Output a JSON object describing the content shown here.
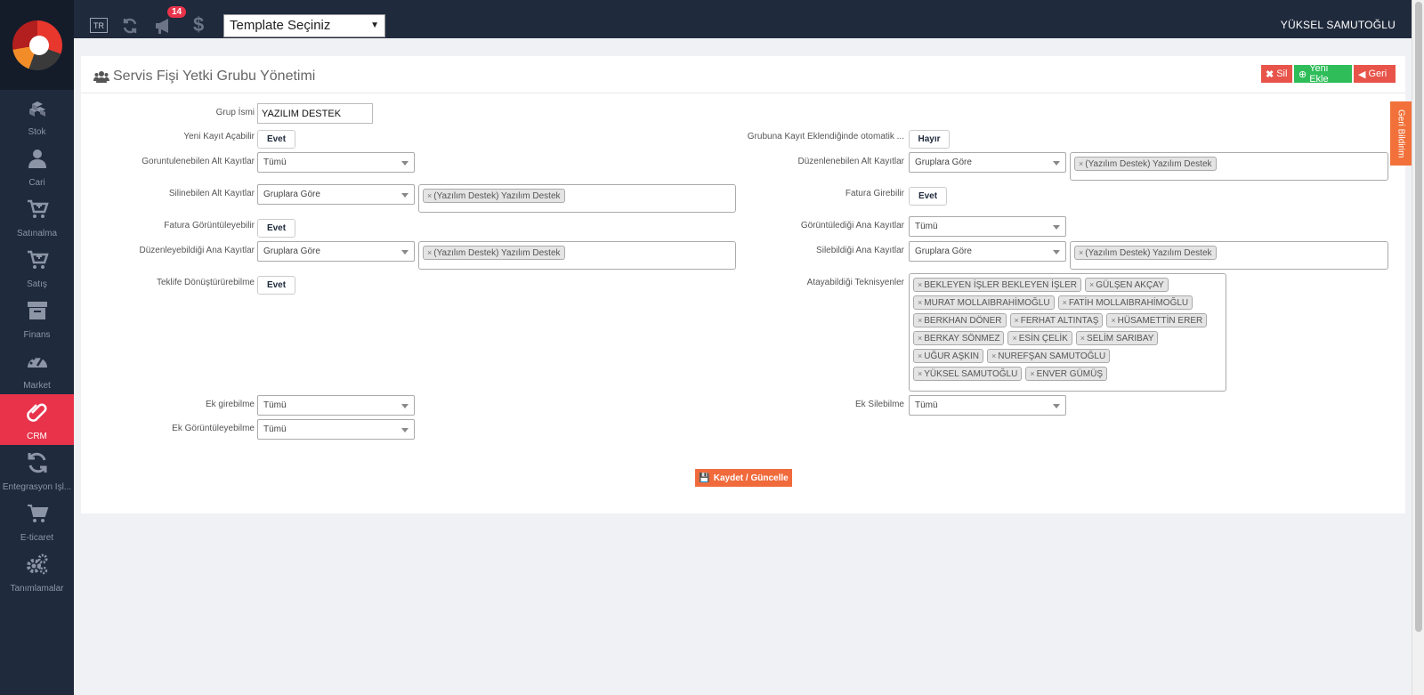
{
  "topbar": {
    "lang": "TR",
    "notification_count": "14",
    "template_select": "Template Seçiniz",
    "username": "YÜKSEL SAMUTOĞLU"
  },
  "sidebar": {
    "items": [
      {
        "label": "Stok",
        "icon": "cubes-icon"
      },
      {
        "label": "Cari",
        "icon": "user-icon"
      },
      {
        "label": "Satınalma",
        "icon": "cart-icon"
      },
      {
        "label": "Satış",
        "icon": "cart-icon"
      },
      {
        "label": "Finans",
        "icon": "archive-icon"
      },
      {
        "label": "Market",
        "icon": "dashboard-icon"
      },
      {
        "label": "CRM",
        "icon": "paperclip-icon",
        "active": true
      },
      {
        "label": "Entegrasyon İşl...",
        "icon": "refresh-icon"
      },
      {
        "label": "E-ticaret",
        "icon": "shopping-cart-icon"
      },
      {
        "label": "Tanımlamalar",
        "icon": "gears-icon"
      }
    ]
  },
  "panel": {
    "title": "Servis Fişi Yetki Grubu Yönetimi",
    "buttons": {
      "delete": "Sil",
      "new": "Yeni Ekle",
      "back": "Geri"
    },
    "side_tab": "Geri Bildirim",
    "save": "Kaydet / Güncelle"
  },
  "form": {
    "grup_ismi": {
      "label": "Grup İsmi",
      "value": "YAZILIM DESTEK"
    },
    "yeni_kayit": {
      "label": "Yeni Kayıt Açabilir",
      "value": "Evet"
    },
    "grubuna_kayit": {
      "label": "Grubuna Kayıt Eklendiğinde otomatik ...",
      "value": "Hayır"
    },
    "goruntulenebilen_alt": {
      "label": "Goruntulenebilen Alt Kayıtlar",
      "value": "Tümü"
    },
    "duzenlenebilen_alt": {
      "label": "Düzenlenebilen Alt Kayıtlar",
      "value": "Gruplara Göre",
      "chips": [
        "(Yazılım Destek) Yazılım Destek"
      ]
    },
    "silinebilen_alt": {
      "label": "Silinebilen Alt Kayıtlar",
      "value": "Gruplara Göre",
      "chips": [
        "(Yazılım Destek) Yazılım Destek"
      ]
    },
    "fatura_girebilir": {
      "label": "Fatura Girebilir",
      "value": "Evet"
    },
    "fatura_goruntuleyebilir": {
      "label": "Fatura Görüntüleyebilir",
      "value": "Evet"
    },
    "goruntuledigi_ana": {
      "label": "Görüntülediği Ana Kayıtlar",
      "value": "Tümü"
    },
    "duzenleyebildigi_ana": {
      "label": "Düzenleyebildiği Ana Kayıtlar",
      "value": "Gruplara Göre",
      "chips": [
        "(Yazılım Destek) Yazılım Destek"
      ]
    },
    "silebildigi_ana": {
      "label": "Silebildiği Ana Kayıtlar",
      "value": "Gruplara Göre",
      "chips": [
        "(Yazılım Destek) Yazılım Destek"
      ]
    },
    "teklife": {
      "label": "Teklife Dönüştürürebilme",
      "value": "Evet"
    },
    "atayabildigi": {
      "label": "Atayabildiği Teknisyenler",
      "chips": [
        "BEKLEYEN İŞLER BEKLEYEN İŞLER",
        "GÜLŞEN AKÇAY",
        "MURAT MOLLAIBRAHİMOĞLU",
        "FATİH MOLLAIBRAHİMOĞLU",
        "BERKHAN DÖNER",
        "FERHAT ALTINTAŞ",
        "HÜSAMETTİN ERER",
        "BERKAY SÖNMEZ",
        "ESİN ÇELİK",
        "SELİM SARIBAY",
        "UĞUR AŞKIN",
        "NUREFŞAN SAMUTOĞLU",
        "YÜKSEL SAMUTOĞLU",
        "ENVER GÜMÜŞ"
      ]
    },
    "ek_girebilme": {
      "label": "Ek girebilme",
      "value": "Tümü"
    },
    "ek_silebilme": {
      "label": "Ek Silebilme",
      "value": "Tümü"
    },
    "ek_goruntuleyebilme": {
      "label": "Ek Görüntüleyebilme",
      "value": "Tümü"
    }
  },
  "colors": {
    "sidebar": "#1f2a3c",
    "active": "#e8334a",
    "save": "#f06a3c",
    "green": "#2ebd59",
    "red": "#e8544a"
  }
}
